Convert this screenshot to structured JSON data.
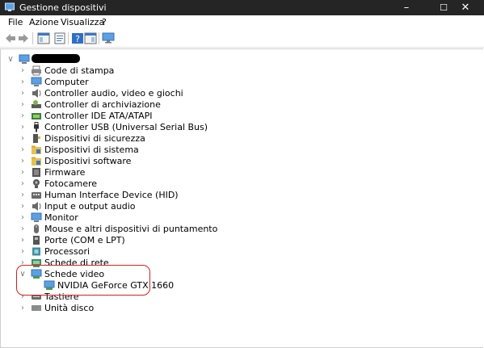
{
  "window": {
    "title": "Gestione dispositivi",
    "controls": {
      "minimize": "–",
      "maximize": "☐",
      "close": "✕"
    }
  },
  "menu": [
    "File",
    "Azione",
    "Visualizza",
    "?"
  ],
  "toolbar": {
    "buttons": [
      "back-icon",
      "forward-icon",
      "console-tree-icon",
      "properties-icon",
      "help-icon",
      "action-pane-icon",
      "monitor-icon"
    ]
  },
  "tree": {
    "root_label_redacted": true,
    "items": [
      "Code di stampa",
      "Computer",
      "Controller audio, video e giochi",
      "Controller di archiviazione",
      "Controller IDE ATA/ATAPI",
      "Controller USB (Universal Serial Bus)",
      "Dispositivi di sicurezza",
      "Dispositivi di sistema",
      "Dispositivi software",
      "Firmware",
      "Fotocamere",
      "Human Interface Device (HID)",
      "Input e output audio",
      "Monitor",
      "Mouse e altri dispositivi di puntamento",
      "Porte (COM e LPT)",
      "Processori",
      "Schede di rete",
      "Schede video",
      "NVIDIA GeForce GTX 1660",
      "Tastiere",
      "Unità disco"
    ],
    "expanded": "Schede video"
  },
  "colors": {
    "titlebar": "#252525",
    "highlight": "#d42020",
    "accent": "#2f7cd0"
  }
}
